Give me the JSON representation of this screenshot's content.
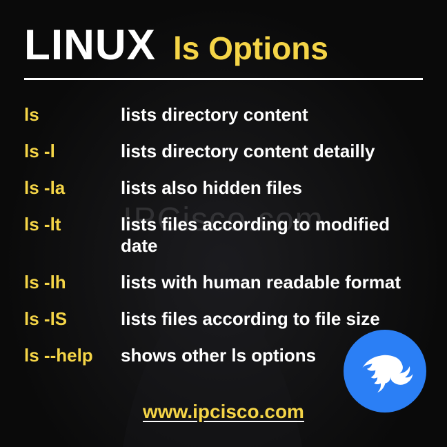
{
  "header": {
    "title_main": "LINUX",
    "title_sub": "ls Options"
  },
  "watermark": "IPCisco.com",
  "options": [
    {
      "cmd": "ls",
      "desc": "lists directory content"
    },
    {
      "cmd": "ls -l",
      "desc": "lists directory content detailly"
    },
    {
      "cmd": "ls -la",
      "desc": "lists also hidden files"
    },
    {
      "cmd": "ls -lt",
      "desc": "lists files according to modified date"
    },
    {
      "cmd": "ls -lh",
      "desc": "lists with human readable format"
    },
    {
      "cmd": "ls -lS",
      "desc": "lists files according to file size"
    },
    {
      "cmd": "ls --help",
      "desc": "shows other ls options"
    }
  ],
  "footer": {
    "url": "www.ipcisco.com"
  },
  "logo": {
    "name": "kali-dragon"
  }
}
